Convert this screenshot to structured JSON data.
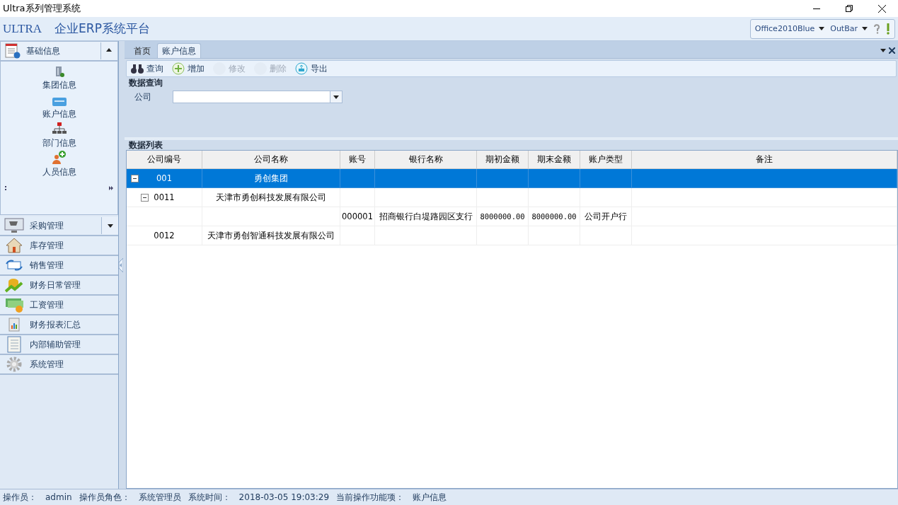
{
  "window": {
    "title": "Ultra系列管理系统"
  },
  "header": {
    "logo": "ULTRA",
    "product": "企业ERP系统平台",
    "skin": "Office2010Blue",
    "layout": "OutBar"
  },
  "sidebar": {
    "open_group": {
      "label": "基础信息",
      "items": [
        {
          "label": "集团信息"
        },
        {
          "label": "账户信息"
        },
        {
          "label": "部门信息"
        },
        {
          "label": "人员信息"
        }
      ]
    },
    "groups": [
      {
        "label": "采购管理",
        "dropdown": true
      },
      {
        "label": "库存管理",
        "dropdown": false
      },
      {
        "label": "销售管理",
        "dropdown": false
      },
      {
        "label": "财务日常管理",
        "dropdown": false
      },
      {
        "label": "工资管理",
        "dropdown": false
      },
      {
        "label": "财务报表汇总",
        "dropdown": false
      },
      {
        "label": "内部辅助管理",
        "dropdown": false
      },
      {
        "label": "系统管理",
        "dropdown": false
      }
    ]
  },
  "tabs": [
    {
      "label": "首页",
      "selected": false
    },
    {
      "label": "账户信息",
      "selected": true
    }
  ],
  "toolbar": [
    {
      "label": "查询",
      "disabled": false
    },
    {
      "label": "增加",
      "disabled": false
    },
    {
      "label": "修改",
      "disabled": true
    },
    {
      "label": "删除",
      "disabled": true
    },
    {
      "label": "导出",
      "disabled": false
    }
  ],
  "query": {
    "title": "数据查询",
    "company_label": "公司"
  },
  "table": {
    "title": "数据列表",
    "columns": [
      "公司编号",
      "公司名称",
      "账号",
      "银行名称",
      "期初金额",
      "期末金额",
      "账户类型",
      "备注"
    ],
    "rows": [
      {
        "code": "001",
        "name": "勇创集团",
        "selected": true,
        "expanded": true,
        "children": [
          {
            "code": "0011",
            "name": "天津市勇创科技发展有限公司",
            "selected": false,
            "expanded": true,
            "children": [
              {
                "account": "000001",
                "bank": "招商银行白堤路园区支行",
                "opening": "8000000.00",
                "closing": "8000000.00",
                "type": "公司开户行",
                "selected": false
              }
            ]
          },
          {
            "code": "0012",
            "name": "天津市勇创智通科技发展有限公司",
            "selected": false
          }
        ]
      }
    ]
  },
  "status_bar": [
    {
      "label": "操作员：",
      "value": "admin"
    },
    {
      "label": "操作员角色：",
      "value": "系统管理员"
    },
    {
      "label": "系统时间：",
      "value": "2018-03-05 19:03:29"
    },
    {
      "label": "当前操作功能项：",
      "value": "账户信息"
    }
  ]
}
